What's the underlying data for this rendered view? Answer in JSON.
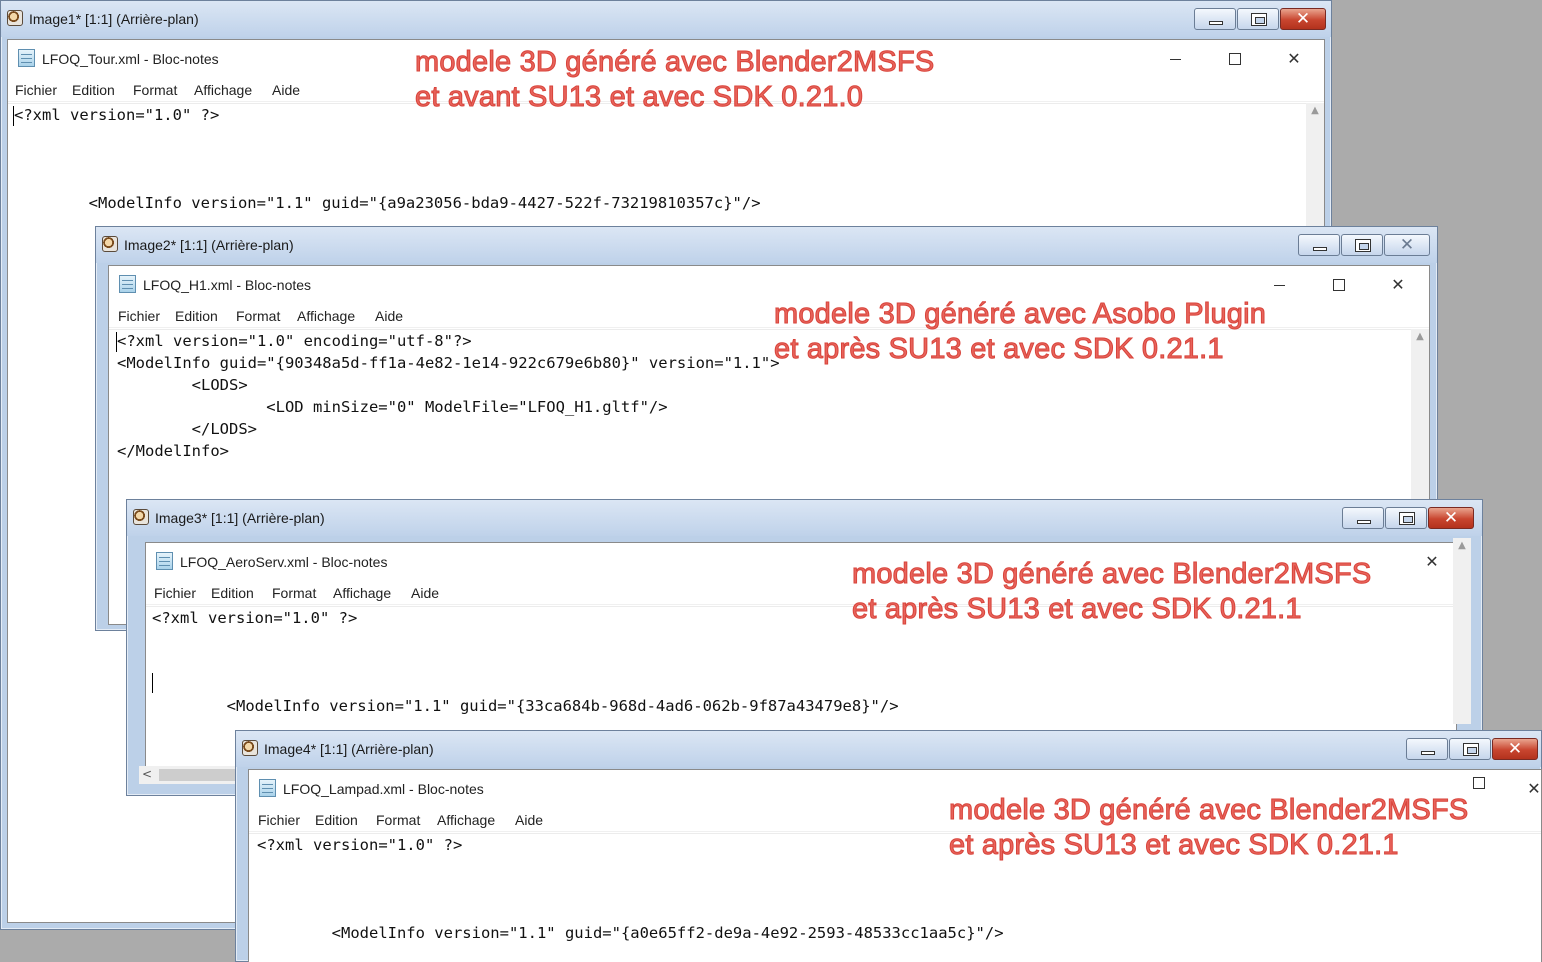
{
  "windows": [
    {
      "viewer_title": "Image1* [1:1] (Arrière-plan)",
      "notepad_title": "LFOQ_Tour.xml - Bloc-notes",
      "menu": [
        "Fichier",
        "Edition",
        "Format",
        "Affichage",
        "Aide"
      ],
      "code_lines": [
        "<?xml version=\"1.0\" ?>",
        "",
        "",
        "",
        "        <ModelInfo version=\"1.1\" guid=\"{a9a23056-bda9-4427-522f-73219810357c}\"/>"
      ],
      "annotation": [
        "modele 3D généré avec Blender2MSFS",
        "et avant SU13 et avec SDK 0.21.0"
      ]
    },
    {
      "viewer_title": "Image2* [1:1] (Arrière-plan)",
      "notepad_title": "LFOQ_H1.xml - Bloc-notes",
      "menu": [
        "Fichier",
        "Edition",
        "Format",
        "Affichage",
        "Aide"
      ],
      "code_lines": [
        "<?xml version=\"1.0\" encoding=\"utf-8\"?>",
        "<ModelInfo guid=\"{90348a5d-ff1a-4e82-1e14-922c679e6b80}\" version=\"1.1\">",
        "        <LODS>",
        "                <LOD minSize=\"0\" ModelFile=\"LFOQ_H1.gltf\"/>",
        "        </LODS>",
        "</ModelInfo>"
      ],
      "annotation": [
        "modele 3D généré avec Asobo Plugin",
        "et après SU13 et avec SDK 0.21.1"
      ]
    },
    {
      "viewer_title": "Image3* [1:1] (Arrière-plan)",
      "notepad_title": "LFOQ_AeroServ.xml - Bloc-notes",
      "menu": [
        "Fichier",
        "Edition",
        "Format",
        "Affichage",
        "Aide"
      ],
      "code_lines": [
        "<?xml version=\"1.0\" ?>",
        "",
        "",
        "",
        "        <ModelInfo version=\"1.1\" guid=\"{33ca684b-968d-4ad6-062b-9f87a43479e8}\"/>"
      ],
      "annotation": [
        "modele 3D généré avec Blender2MSFS",
        "et après SU13 et avec SDK 0.21.1"
      ]
    },
    {
      "viewer_title": "Image4* [1:1] (Arrière-plan)",
      "notepad_title": "LFOQ_Lampad.xml - Bloc-notes",
      "menu": [
        "Fichier",
        "Edition",
        "Format",
        "Affichage",
        "Aide"
      ],
      "code_lines": [
        "<?xml version=\"1.0\" ?>",
        "",
        "",
        "",
        "        <ModelInfo version=\"1.1\" guid=\"{a0e65ff2-de9a-4e92-2593-48533cc1aa5c}\"/>"
      ],
      "annotation": [
        "modele 3D généré avec Blender2MSFS",
        "et après SU13 et avec SDK 0.21.1"
      ]
    }
  ],
  "icons": {
    "viewer": "image-viewer-icon",
    "notepad": "notepad-icon",
    "minimize": "minimize-icon",
    "maximize": "maximize-icon",
    "close": "close-icon"
  },
  "colors": {
    "annotation": "#e8645c",
    "close_button": "#c8452f",
    "titlebar": "#bfd2ea"
  }
}
